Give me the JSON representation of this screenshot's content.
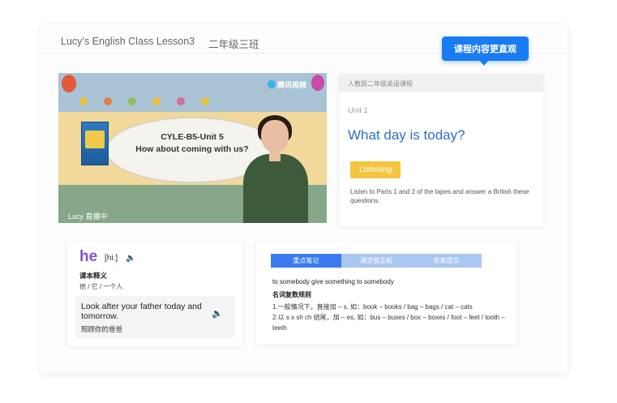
{
  "header": {
    "class_title": "Lucy’s English Class  Lesson3",
    "class_group": "二年级三班"
  },
  "tooltip": {
    "label": "课程内容更直观"
  },
  "video": {
    "title_line1": "CYLE-B5-Unit 5",
    "title_line2": "How about coming with us?",
    "badge": "腾讯视频",
    "live_label": "Lucy 直播中"
  },
  "course": {
    "header": "人教版二年级英语课程",
    "unit": "Unit 1",
    "title": "What day is today?",
    "tag": "Listening",
    "description": "Listen to Parts 1 and 2 of the tapes and answer a British these questions."
  },
  "dictionary": {
    "word": "he",
    "phonetic": "[hi:]",
    "speaker_icon": "🔈",
    "meaning_label": "课本释义",
    "meaning": "他 / 它 / 一个人",
    "sentence": "Look after your father today and tomorrow.",
    "sentence_cn": "照顾你的爸爸"
  },
  "notes": {
    "tabs": [
      "重点笔记",
      "课堂留言板",
      "答案提交"
    ],
    "active_tab": 0,
    "line1": "to  somebody give something to somebody",
    "heading": "名词复数规则",
    "rule1": "1.一般情况下，直接加 – s, 如：book – books / bag – bags / cat – cats",
    "rule2": "2.以 s x sh ch 结尾，加 – es, 如：bus – buses / box – boxes / foot – feet / tooth – teeth"
  },
  "colors": {
    "accent": "#1a7cf2",
    "title_blue": "#2f6ec6",
    "tag_yellow": "#f4c63f",
    "word_purple": "#7d55c9",
    "tab_active": "#3a7bf0"
  }
}
